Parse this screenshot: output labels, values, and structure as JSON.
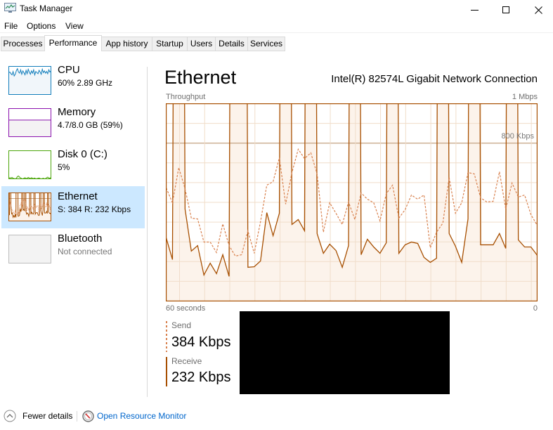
{
  "window": {
    "title": "Task Manager"
  },
  "menu": {
    "items": [
      {
        "label": "File"
      },
      {
        "label": "Options"
      },
      {
        "label": "View"
      }
    ]
  },
  "tabs": {
    "active": "Performance",
    "items": [
      {
        "label": "Processes"
      },
      {
        "label": "Performance"
      },
      {
        "label": "App history"
      },
      {
        "label": "Startup"
      },
      {
        "label": "Users"
      },
      {
        "label": "Details"
      },
      {
        "label": "Services"
      }
    ]
  },
  "sidebar": {
    "selected": "Ethernet",
    "items": [
      {
        "name": "CPU",
        "detail": "60% 2.89 GHz",
        "color": "#117DBB",
        "fill": "#F1F6FA",
        "history_percent": [
          78,
          80,
          74,
          70,
          82,
          66,
          72,
          85,
          92,
          80,
          76,
          88,
          72,
          84,
          78,
          70,
          86,
          74,
          90,
          80,
          72,
          84,
          76,
          88,
          70,
          82,
          78,
          74,
          86,
          80,
          72,
          90,
          78,
          84,
          76,
          82,
          74,
          88,
          80,
          84
        ]
      },
      {
        "name": "Memory",
        "detail": "4.7/8.0 GB (59%)",
        "color": "#8B12AE",
        "fill": "#F4F2F4",
        "used_fraction": 0.59
      },
      {
        "name": "Disk 0 (C:)",
        "detail": "5%",
        "color": "#4DA60C",
        "fill": "#EFF7E9",
        "history_percent": [
          2,
          4,
          3,
          5,
          2,
          1,
          0,
          2,
          8,
          10,
          6,
          3,
          1,
          0,
          2,
          4,
          1,
          2,
          5,
          3,
          1,
          4,
          2,
          1,
          3,
          0,
          1,
          2,
          3,
          1,
          0,
          1,
          2,
          0,
          1,
          4,
          6,
          3,
          2,
          5
        ]
      },
      {
        "name": "Ethernet",
        "detail": "S: 384 R: 232 Kbps",
        "color": "#A74F01",
        "fill": "#FCF3EB"
      },
      {
        "name": "Bluetooth",
        "detail": "Not connected",
        "color": "#BDBDBD",
        "fill": "#F3F3F3"
      }
    ]
  },
  "main": {
    "title": "Ethernet",
    "adapter": "Intel(R) 82574L Gigabit Network Connection",
    "throughput_label": "Throughput",
    "max_label": "1 Mbps",
    "ref_label": "800 Kbps",
    "time_label": "60 seconds",
    "zero_label": "0",
    "send": {
      "label": "Send",
      "value": "384 Kbps"
    },
    "receive": {
      "label": "Receive",
      "value": "232 Kbps"
    }
  },
  "footer": {
    "fewer_details": "Fewer details",
    "fewer_details_icon": "chevron-up-circle-icon",
    "resource_monitor": "Open Resource Monitor",
    "resource_monitor_icon": "resource-monitor-icon"
  },
  "colors": {
    "selected_bg": "#CCE8FF",
    "link": "#0066CC",
    "send": "#D9824F",
    "receive": "#A74F01",
    "receive_fill": "#FCF3EB",
    "grid": "#F0DDCA",
    "ref_line": "#C9A98B"
  },
  "chart_data": {
    "type": "line",
    "title": "Ethernet",
    "subtitle": "Intel(R) 82574L Gigabit Network Connection",
    "ylabel": "Throughput",
    "xlabel": "",
    "x_labels": [
      "60 seconds",
      "0"
    ],
    "xlim": [
      60,
      0
    ],
    "ylim": [
      0,
      1000
    ],
    "y_unit": "Kbps",
    "y_max_label": "1 Mbps",
    "reference_lines": [
      {
        "value": 800,
        "label": "800 Kbps"
      }
    ],
    "grid": true,
    "legend": "bottom-left",
    "series": [
      {
        "name": "Send",
        "style": "dashed",
        "values": [
          573,
          498,
          676,
          569,
          420,
          416,
          299,
          299,
          246,
          391,
          281,
          228,
          235,
          356,
          242,
          402,
          587,
          605,
          726,
          491,
          651,
          769,
          722,
          751,
          644,
          349,
          498,
          445,
          388,
          502,
          413,
          548,
          516,
          498,
          406,
          544,
          587,
          420,
          463,
          537,
          516,
          537,
          270,
          349,
          395,
          626,
          445,
          498,
          651,
          644,
          523,
          502,
          505,
          655,
          466,
          598,
          527,
          537,
          438,
          384
        ]
      },
      {
        "name": "Receive",
        "style": "solid-filled",
        "values": [
          320,
          210,
          8000,
          466,
          253,
          281,
          132,
          192,
          139,
          235,
          125,
          8000,
          8000,
          171,
          174,
          203,
          448,
          331,
          445,
          8000,
          388,
          413,
          356,
          8000,
          342,
          242,
          288,
          256,
          171,
          281,
          8000,
          235,
          313,
          274,
          242,
          295,
          8000,
          242,
          285,
          299,
          292,
          221,
          196,
          217,
          8000,
          342,
          278,
          196,
          416,
          8000,
          285,
          285,
          285,
          342,
          267,
          8000,
          310,
          274,
          274,
          232
        ]
      }
    ]
  }
}
